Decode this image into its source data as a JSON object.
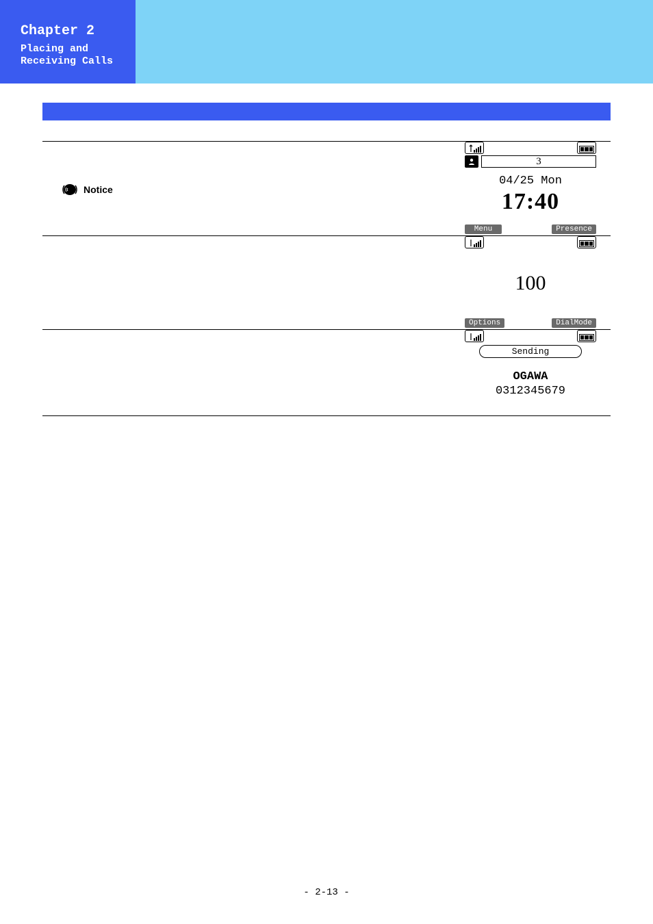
{
  "chapter": {
    "title": "Chapter 2",
    "subtitle_line1": "Placing and",
    "subtitle_line2": "Receiving Calls"
  },
  "notice_label": "Notice",
  "screens": {
    "home": {
      "badge_count": "3",
      "date": "04/25 Mon",
      "time": "17:40",
      "softkey_left": "Menu",
      "softkey_right": "Presence"
    },
    "dialing": {
      "number": "100",
      "softkey_left": "Options",
      "softkey_right": "DialMode"
    },
    "sending": {
      "status": "Sending",
      "contact_name": "OGAWA",
      "contact_number": "0312345679"
    }
  },
  "footer": "- 2-13 -"
}
